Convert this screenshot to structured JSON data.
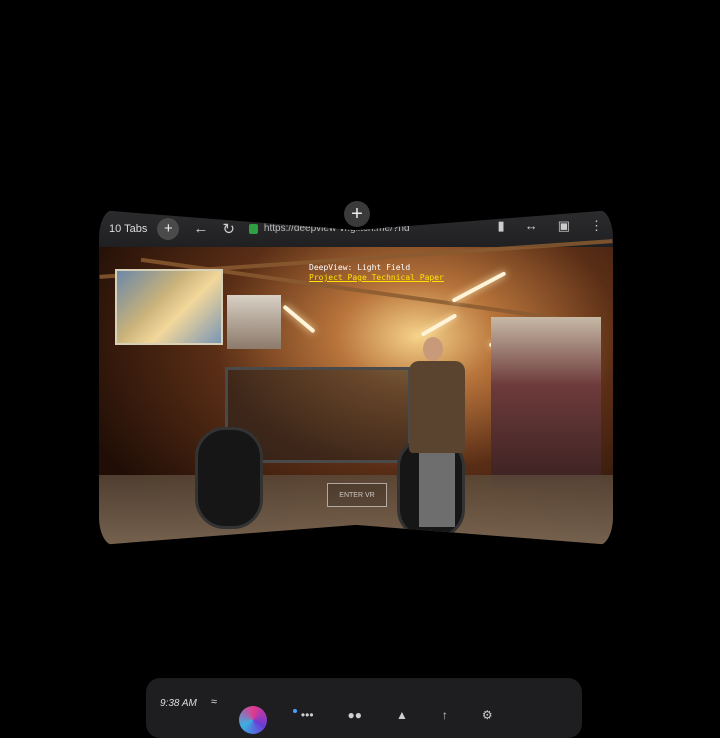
{
  "browser": {
    "tabs_label": "10 Tabs",
    "url": "https://deepview-vr.glitch.me/?hd"
  },
  "overlay": {
    "line1": "DeepView: Light Field",
    "line2": "Project Page  Technical Paper"
  },
  "enter_vr": "ENTER VR",
  "system_bar": {
    "time": "9:38 AM"
  },
  "icons": {
    "float_add": "plus-icon",
    "new_tab": "plus-icon",
    "back": "back-arrow-icon",
    "reload": "reload-icon",
    "lock": "lock-icon",
    "bookmark": "bookmark-icon",
    "resize": "resize-width-icon",
    "cast": "screen-icon",
    "menu": "more-vertical-icon"
  },
  "colors": {
    "lock": "#2ea043",
    "link": "#ffe400"
  }
}
